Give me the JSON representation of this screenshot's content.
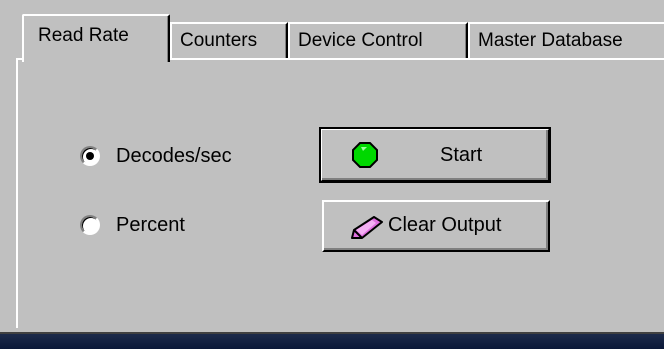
{
  "tabs": [
    {
      "label": "Read Rate",
      "active": true
    },
    {
      "label": "Counters",
      "active": false
    },
    {
      "label": "Device Control",
      "active": false
    },
    {
      "label": "Master Database",
      "active": false
    }
  ],
  "display_mode": {
    "options": [
      {
        "label": "Decodes/sec",
        "selected": true
      },
      {
        "label": "Percent",
        "selected": false
      }
    ]
  },
  "buttons": {
    "start": {
      "label": "Start",
      "icon": "green-octagon-icon"
    },
    "clear_output": {
      "label": "Clear Output",
      "icon": "eraser-icon"
    }
  },
  "colors": {
    "start_icon": "#00d800",
    "eraser_icon": "#e070e0"
  }
}
